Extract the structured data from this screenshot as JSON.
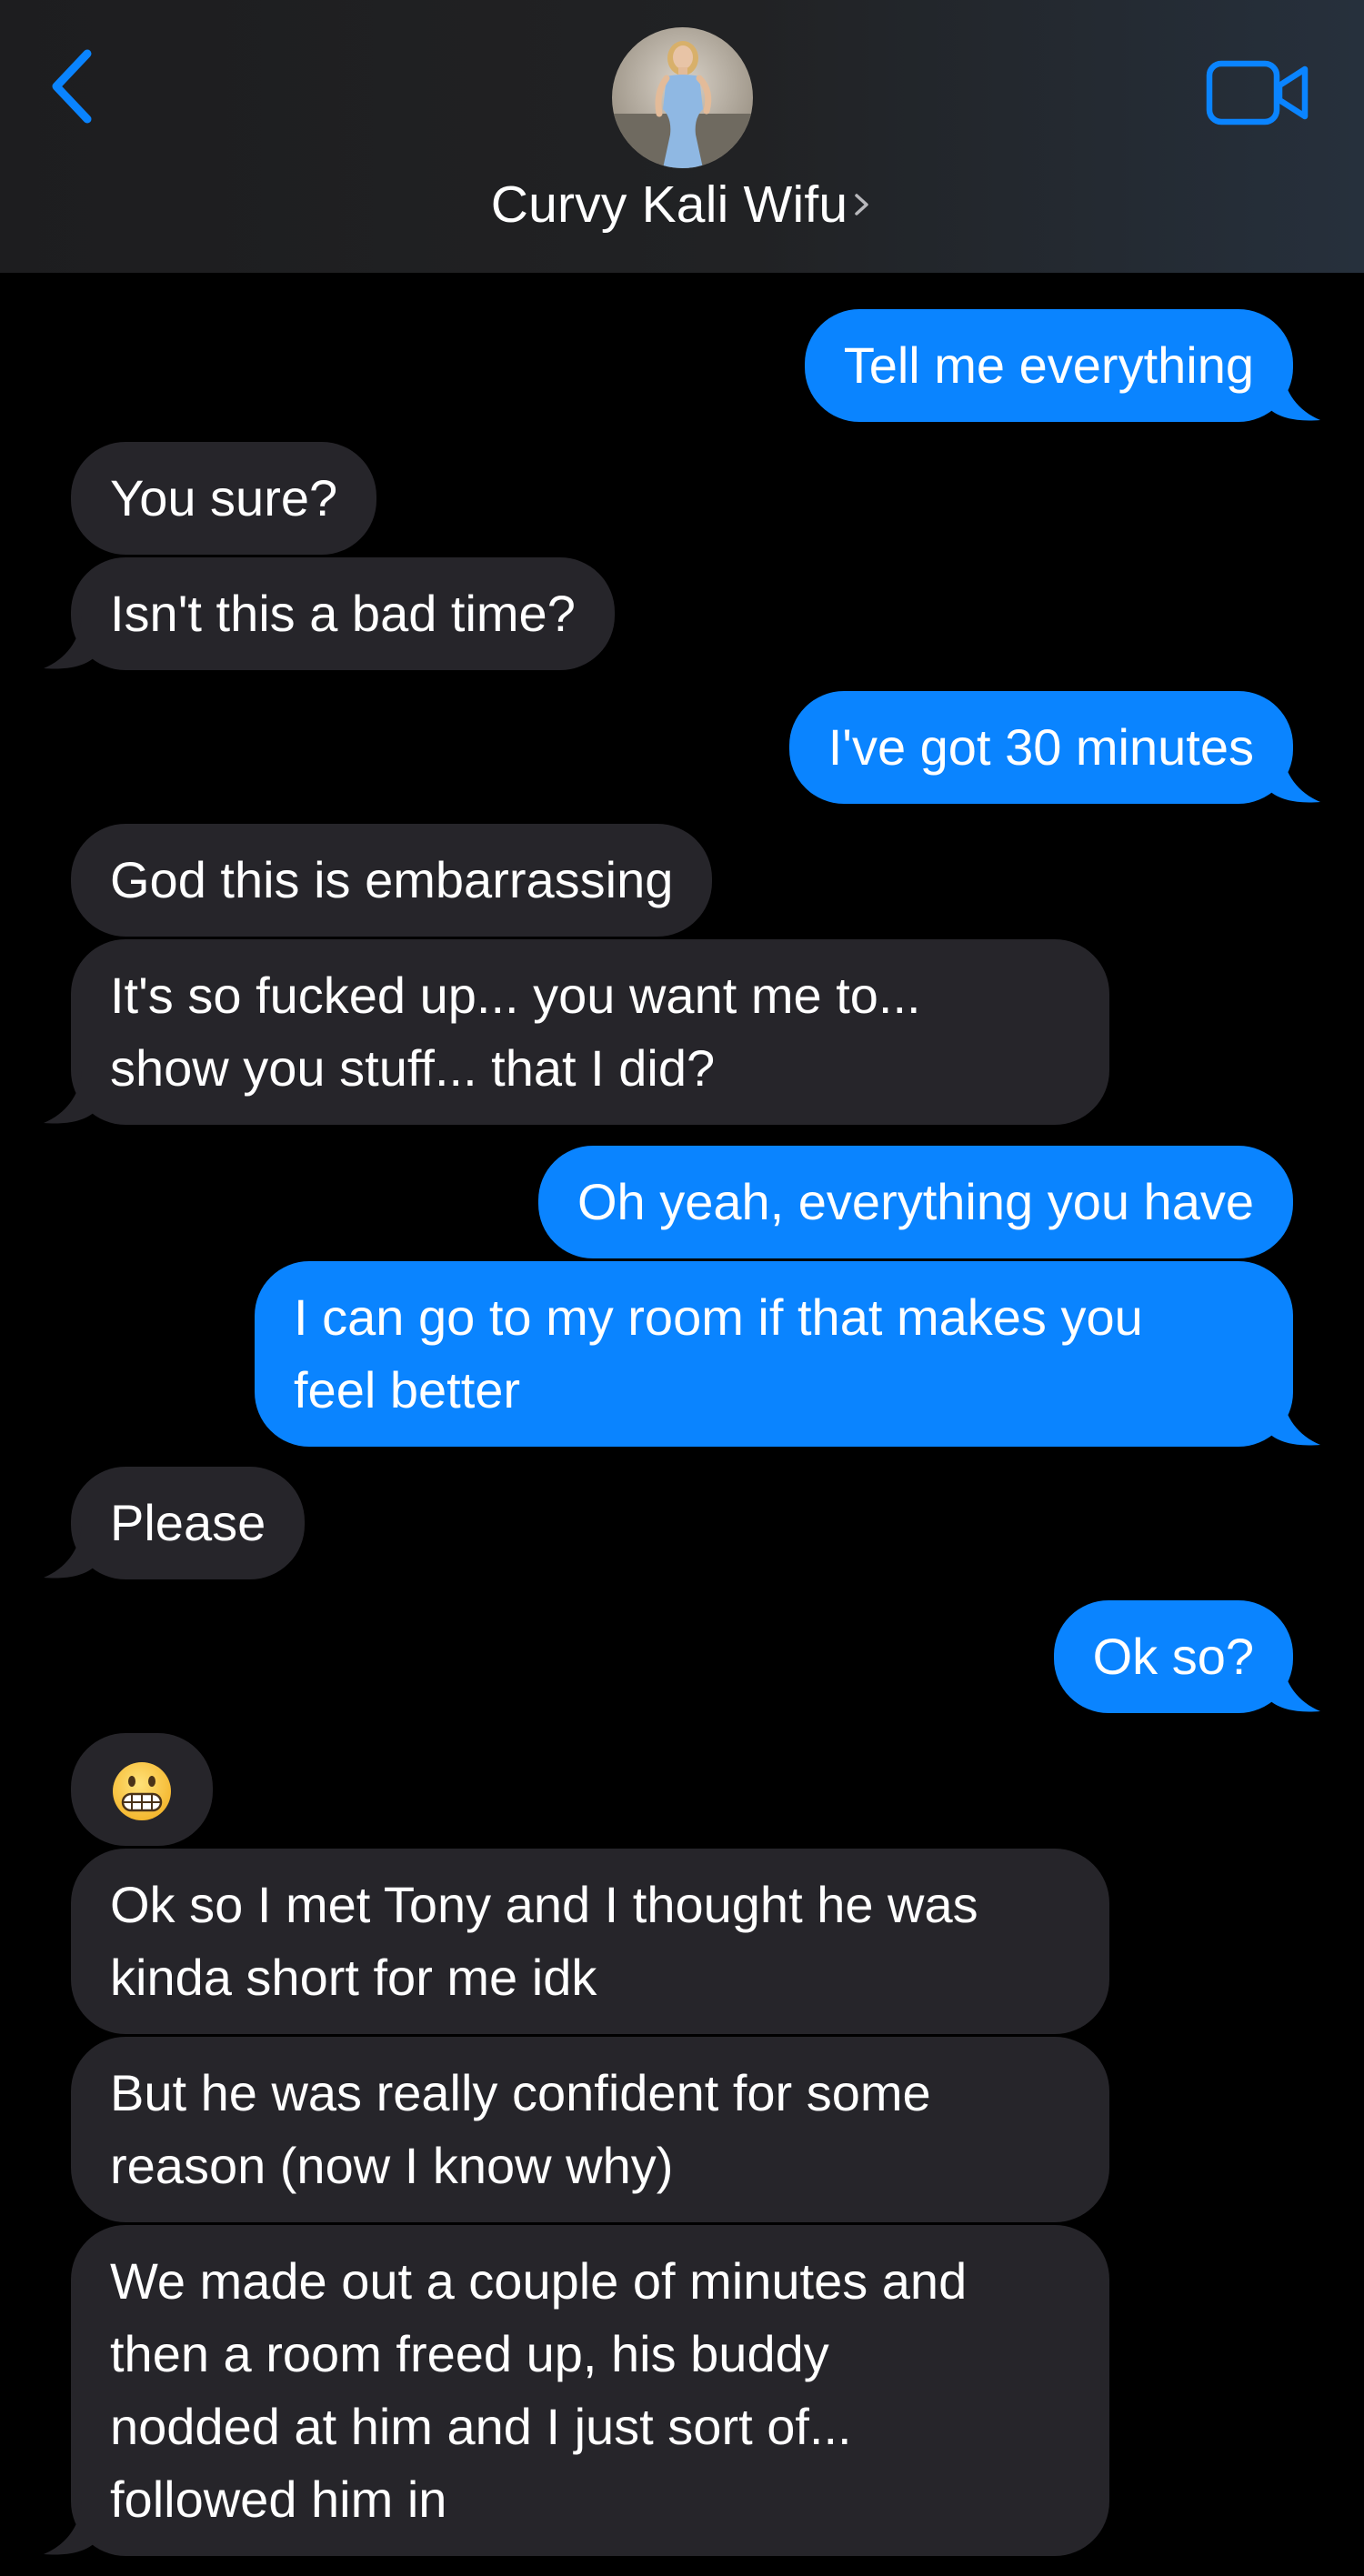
{
  "header": {
    "back_icon": "chevron-left-icon",
    "contact_name": "Curvy Kali Wifu",
    "avatar_icon": "contact-avatar",
    "video_icon": "video-camera-icon",
    "accent_color": "#0a84ff"
  },
  "messages": [
    {
      "from": "me",
      "text": "Tell me everything"
    },
    {
      "from": "contact",
      "text": "You sure?"
    },
    {
      "from": "contact",
      "text": "Isn't this a bad time?"
    },
    {
      "from": "me",
      "text": "I've got 30 minutes"
    },
    {
      "from": "contact",
      "text": "God this is embarrassing"
    },
    {
      "from": "contact",
      "lines": [
        "It's so fucked up... you want me to...",
        "show you stuff... that I did?"
      ]
    },
    {
      "from": "me",
      "text": "Oh yeah, everything you have"
    },
    {
      "from": "me",
      "lines": [
        "I can go to my room if that makes you",
        "feel better"
      ]
    },
    {
      "from": "contact",
      "text": "Please"
    },
    {
      "from": "me",
      "text": "Ok so?"
    },
    {
      "from": "contact",
      "emoji": "grimacing-face-emoji"
    },
    {
      "from": "contact",
      "lines": [
        "Ok so I met Tony and I thought he was",
        "kinda short for me idk"
      ]
    },
    {
      "from": "contact",
      "lines": [
        "But he was really confident for some",
        "reason (now I know why)"
      ]
    },
    {
      "from": "contact",
      "lines": [
        "We made out a couple of minutes and",
        "then a room freed up, his buddy",
        "nodded at him and I just sort of...",
        "followed him in"
      ]
    }
  ],
  "colors": {
    "incoming_bubble": "#26252a",
    "outgoing_bubble": "#0a84ff",
    "background": "#000000"
  }
}
